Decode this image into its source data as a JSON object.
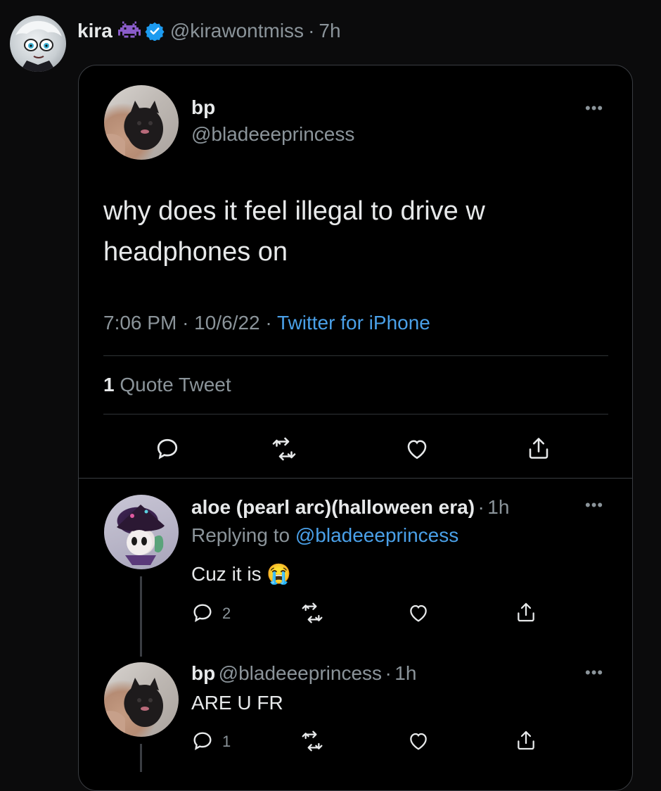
{
  "outer_tweet": {
    "author_name": "kira",
    "author_handle": "@kirawontmiss",
    "time": "7h",
    "emoji_icon": "alien-monster-icon",
    "verified_icon": "verified-badge-icon",
    "accent_color": "#1d9bf0"
  },
  "quoted_tweet": {
    "author_name": "bp",
    "author_handle": "@bladeeeprincess",
    "text": "why does it feel illegal to drive w headphones on",
    "time": "7:06 PM",
    "date": "10/6/22",
    "source": "Twitter for iPhone",
    "quote_count": "1",
    "quote_label": "Quote Tweet",
    "more_icon": "more-dots-icon"
  },
  "replies": [
    {
      "author_name": "aloe (pearl arc)(halloween era)",
      "time": "1h",
      "replying_to_label": "Replying to",
      "replying_to_handle": "@bladeeeprincess",
      "text": "Cuz it is",
      "emoji": "😭",
      "reply_count": "2"
    },
    {
      "author_name": "bp",
      "author_handle": "@bladeeeprincess",
      "time": "1h",
      "text": "ARE U FR",
      "reply_count": "1"
    }
  ],
  "separators": {
    "dot": "·"
  }
}
